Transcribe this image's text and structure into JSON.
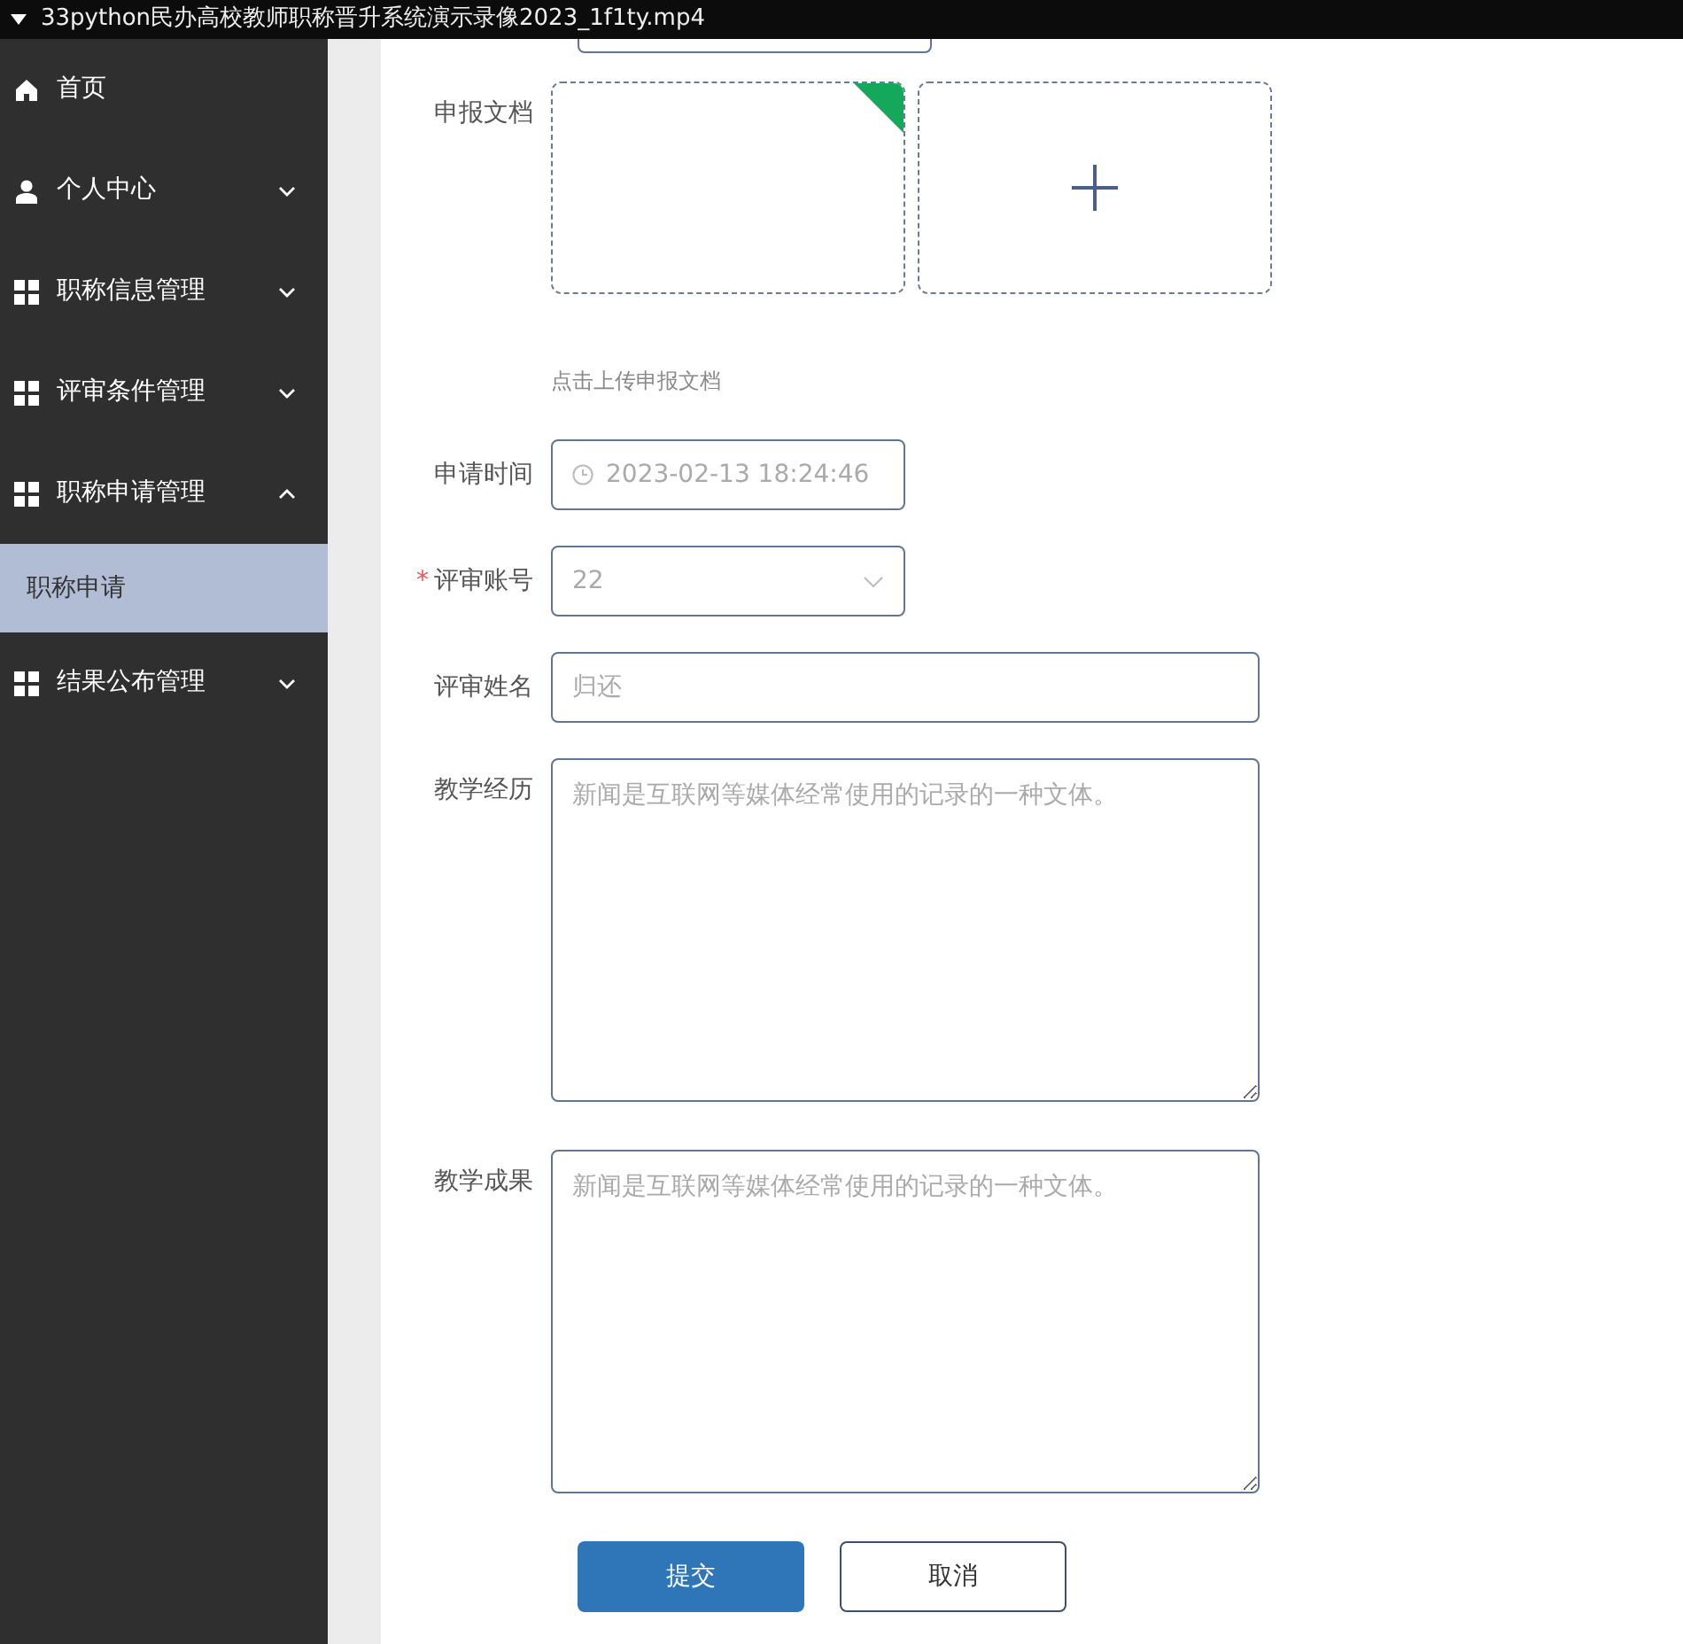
{
  "window": {
    "title": "33python民办高校教师职称晋升系统演示录像2023_1f1ty.mp4"
  },
  "sidebar": {
    "items": [
      {
        "label": "首页"
      },
      {
        "label": "个人中心",
        "expanded": false
      },
      {
        "label": "职称信息管理",
        "expanded": false
      },
      {
        "label": "评审条件管理",
        "expanded": false
      },
      {
        "label": "职称申请管理",
        "expanded": true,
        "children": [
          {
            "label": "职称申请",
            "selected": true
          }
        ]
      },
      {
        "label": "结果公布管理",
        "expanded": false
      }
    ]
  },
  "form": {
    "fields": [
      {
        "kind": "upload",
        "label": "申报文档",
        "tiles": [
          {
            "uploaded": true
          },
          {
            "uploaded": false
          }
        ],
        "hint": "点击上传申报文档"
      },
      {
        "kind": "datetime",
        "label": "申请时间",
        "value": "2023-02-13 18:24:46"
      },
      {
        "kind": "select",
        "label": "评审账号",
        "required_mark": "*",
        "value": "22"
      },
      {
        "kind": "text",
        "label": "评审姓名",
        "value": "归还"
      },
      {
        "kind": "textarea",
        "label": "教学经历",
        "placeholder": "新闻是互联网等媒体经常使用的记录的一种文体。"
      },
      {
        "kind": "textarea",
        "label": "教学成果",
        "placeholder": "新闻是互联网等媒体经常使用的记录的一种文体。"
      }
    ],
    "buttons": [
      {
        "label": "提交",
        "kind": "primary"
      },
      {
        "label": "取消",
        "kind": "secondary"
      }
    ]
  }
}
